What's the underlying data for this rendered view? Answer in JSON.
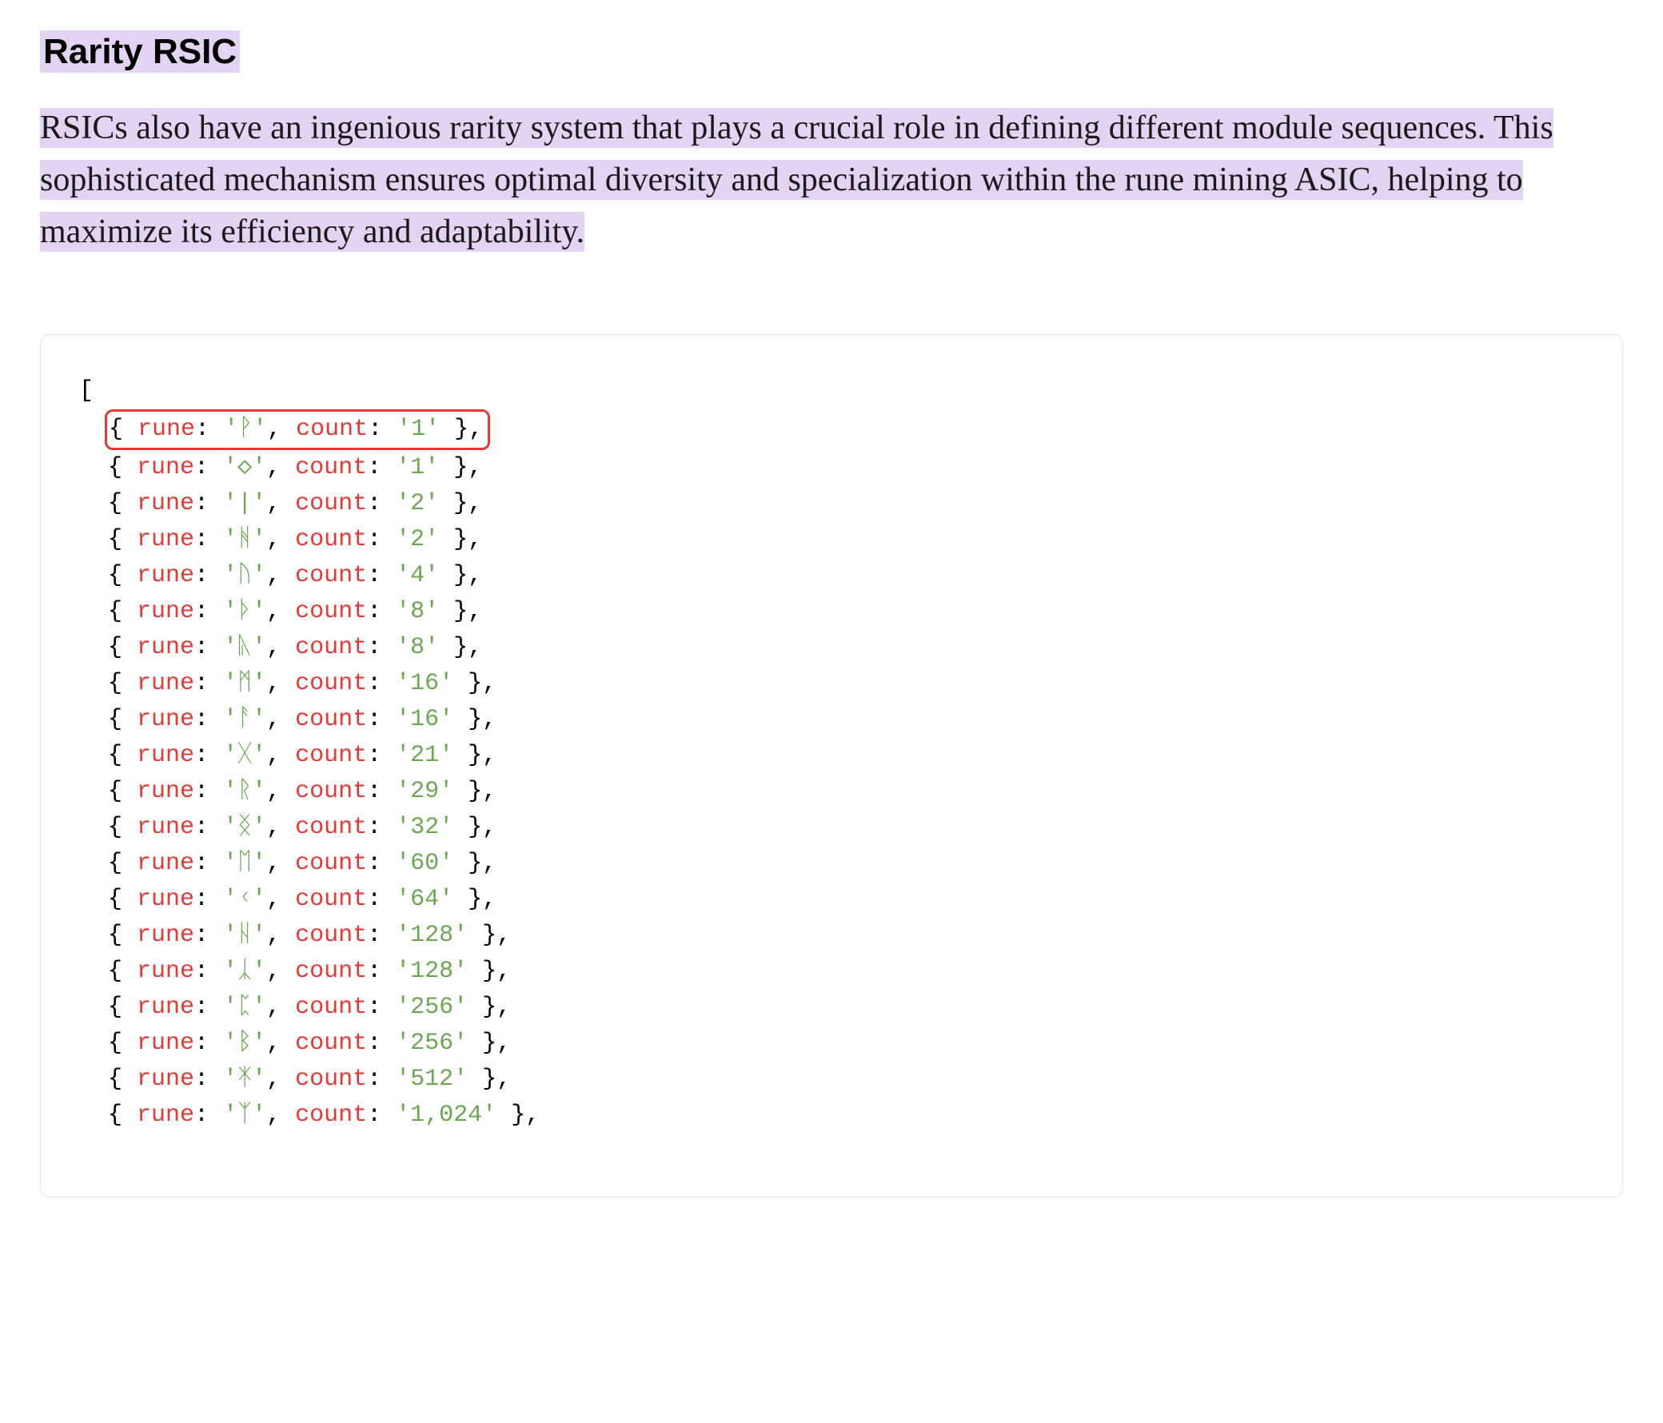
{
  "heading": "Rarity RSIC",
  "paragraph": "RSICs also have an ingenious rarity system that plays a crucial role in defining different module sequences. This sophisticated mechanism ensures optimal diversity and specialization within the rune mining ASIC, helping to maximize its efficiency and adaptability.",
  "code": {
    "open_bracket": "[",
    "entries": [
      {
        "rune": "ᚹ",
        "count": "1",
        "highlighted": true
      },
      {
        "rune": "◇",
        "count": "1"
      },
      {
        "rune": "|",
        "count": "2"
      },
      {
        "rune": "ᚻ",
        "count": "2"
      },
      {
        "rune": "ᚢ",
        "count": "4"
      },
      {
        "rune": "ᚦ",
        "count": "8"
      },
      {
        "rune": "ᚣ",
        "count": "8"
      },
      {
        "rune": "ᛗ",
        "count": "16"
      },
      {
        "rune": "ᚨ",
        "count": "16"
      },
      {
        "rune": "ᚷ",
        "count": "21"
      },
      {
        "rune": "ᚱ",
        "count": "29"
      },
      {
        "rune": "ᛝ",
        "count": "32"
      },
      {
        "rune": "ᛖ",
        "count": "60"
      },
      {
        "rune": "ᚲ",
        "count": "64"
      },
      {
        "rune": "ᚺ",
        "count": "128"
      },
      {
        "rune": "ᛣ",
        "count": "128"
      },
      {
        "rune": "ᛈ",
        "count": "256"
      },
      {
        "rune": "ᛒ",
        "count": "256"
      },
      {
        "rune": "ᛡ",
        "count": "512"
      },
      {
        "rune": "ᛉ",
        "count": "1,024"
      }
    ],
    "key_rune": "rune",
    "key_count": "count"
  }
}
